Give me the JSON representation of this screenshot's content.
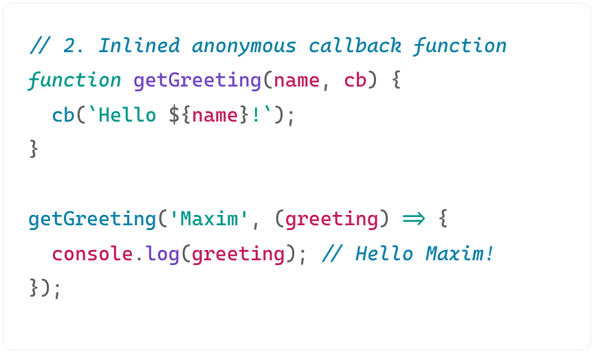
{
  "code": {
    "line1_comment": "// 2. Inlined anonymous callback function",
    "line2": {
      "keyword": "function",
      "sp1": " ",
      "fnname": "getGreeting",
      "open_paren": "(",
      "p1": "name",
      "comma_sp": ", ",
      "p2": "cb",
      "close_paren_brace": ") {"
    },
    "line3": {
      "indent": "  ",
      "fn": "cb",
      "open_paren": "(",
      "bt1": "`",
      "str1": "Hello ",
      "iopen": "${",
      "ivar": "name",
      "iclose": "}",
      "str2": "!",
      "bt2": "`",
      "close": ");"
    },
    "line4_close": "}",
    "blank": "",
    "line6": {
      "fn": "getGreeting",
      "open_paren": "(",
      "q1": "'",
      "arg1": "Maxim",
      "q2": "'",
      "comma_sp": ", ",
      "lp": "(",
      "p": "greeting",
      "rp": ")",
      "sp_arrow_sp": " ",
      "arrow": "=>",
      "sp2": " ",
      "brace": "{"
    },
    "line7": {
      "indent": "  ",
      "obj": "console",
      "dot": ".",
      "method": "log",
      "open_paren": "(",
      "arg": "greeting",
      "close": "); ",
      "comment": "// Hello Maxim!"
    },
    "line8_close": "});"
  }
}
